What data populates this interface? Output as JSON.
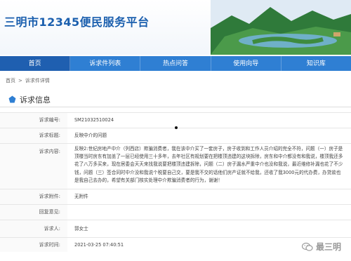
{
  "header": {
    "site_title": "三明市12345便民服务平台"
  },
  "nav": {
    "items": [
      {
        "label": "首页"
      },
      {
        "label": "诉求件列表"
      },
      {
        "label": "热点问答"
      },
      {
        "label": "使用向导"
      },
      {
        "label": "知识库"
      }
    ],
    "active_index": 0
  },
  "breadcrumb": {
    "home": "首页",
    "separator": ">",
    "current": "诉求件详情"
  },
  "section": {
    "title": "诉求信息"
  },
  "form": {
    "number_label": "诉求编号:",
    "number_value": "SM21032510024",
    "topic_label": "诉求标题:",
    "topic_value": "反映中介的问题",
    "content_label": "诉求内容:",
    "content_value": "反映2:世纪房地产中介（列西店）欺骗消费者，我在该中介买了一套房子，房子收到和工作人员介绍的完全不符，问题（一）房子是顶楼当时房东有加盖了一层已经使用三十多年，去年社区有规划要在把楼顶违建的这块拆除，房东和中介都没有和我说，楼顶我还多花了八万多买来，现在居委会天天来找我说要把楼顶违建拆除，问题（二）房子漏水严重中介也没和我说，最近维修补漏也花了不少钱，问题（三）签合同时中介没和我说个税要自己交，要是我不交的话他们房产证就不给我，还收了我3000元的代办费，办贷款也是我自己去办的，希望有关部门核实处理中介欺骗消费者的行为，谢谢！",
    "attach_label": "诉求附件:",
    "attach_value": "无附件",
    "reply_label": "回复意见:",
    "reply_value": "",
    "person_label": "诉求人:",
    "person_value": "郭女士",
    "time_label": "诉求时间:",
    "time_value": "2021-03-25 07:40:51"
  },
  "watermark": {
    "text": "最三明"
  },
  "colors": {
    "nav_bg": "#2f7fd3",
    "nav_active": "#1f5fb0",
    "title_blue": "#1b5fae"
  }
}
